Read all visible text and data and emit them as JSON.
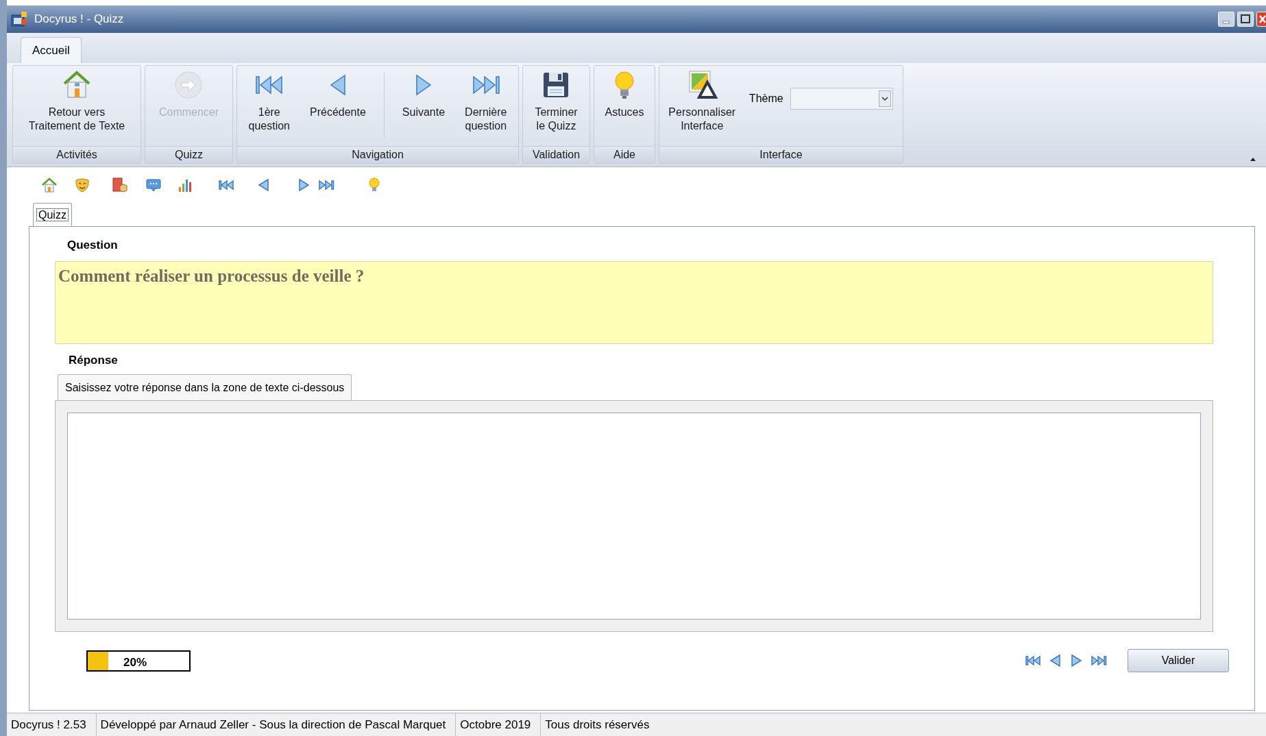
{
  "window": {
    "title": "Docyrus ! - Quizz"
  },
  "ribbon_tabs": [
    {
      "label": "Accueil",
      "selected": true
    }
  ],
  "ribbon_groups": [
    {
      "label": "Activités",
      "buttons": [
        {
          "label": "Retour vers\nTraitement de Texte",
          "disabled": false
        }
      ]
    },
    {
      "label": "Quizz",
      "buttons": [
        {
          "label": "Commencer",
          "disabled": true
        }
      ]
    },
    {
      "label": "Navigation",
      "buttons": [
        {
          "label": "1ère\nquestion",
          "disabled": false
        },
        {
          "label": "Précédente",
          "disabled": false
        },
        {
          "label": "Suivante",
          "disabled": false
        },
        {
          "label": "Dernière\nquestion",
          "disabled": false
        }
      ]
    },
    {
      "label": "Validation",
      "buttons": [
        {
          "label": "Terminer\nle Quizz",
          "disabled": false
        }
      ]
    },
    {
      "label": "Aide",
      "buttons": [
        {
          "label": "Astuces",
          "disabled": false
        }
      ]
    },
    {
      "label": "Interface",
      "buttons": [
        {
          "label": "Personnaliser\nInterface",
          "disabled": false
        }
      ],
      "theme_label": "Thème"
    }
  ],
  "doc_tabs": [
    {
      "label": "Quizz",
      "selected": true
    }
  ],
  "question": {
    "label": "Question",
    "text": "Comment réaliser un processus de veille ?"
  },
  "answer": {
    "label": "Réponse",
    "tabs": [
      {
        "label": "Saisissez votre réponse dans la zone de texte ci-dessous",
        "selected": true
      }
    ]
  },
  "progress": {
    "level": 0.2,
    "reading": "20%"
  },
  "validate_button": "Valider",
  "status_bar": [
    "Docyrus ! 2.53",
    "Développé par Arnaud Zeller - Sous la direction de Pascal Marquet",
    "Octobre 2019",
    "Tous droits réservés"
  ]
}
